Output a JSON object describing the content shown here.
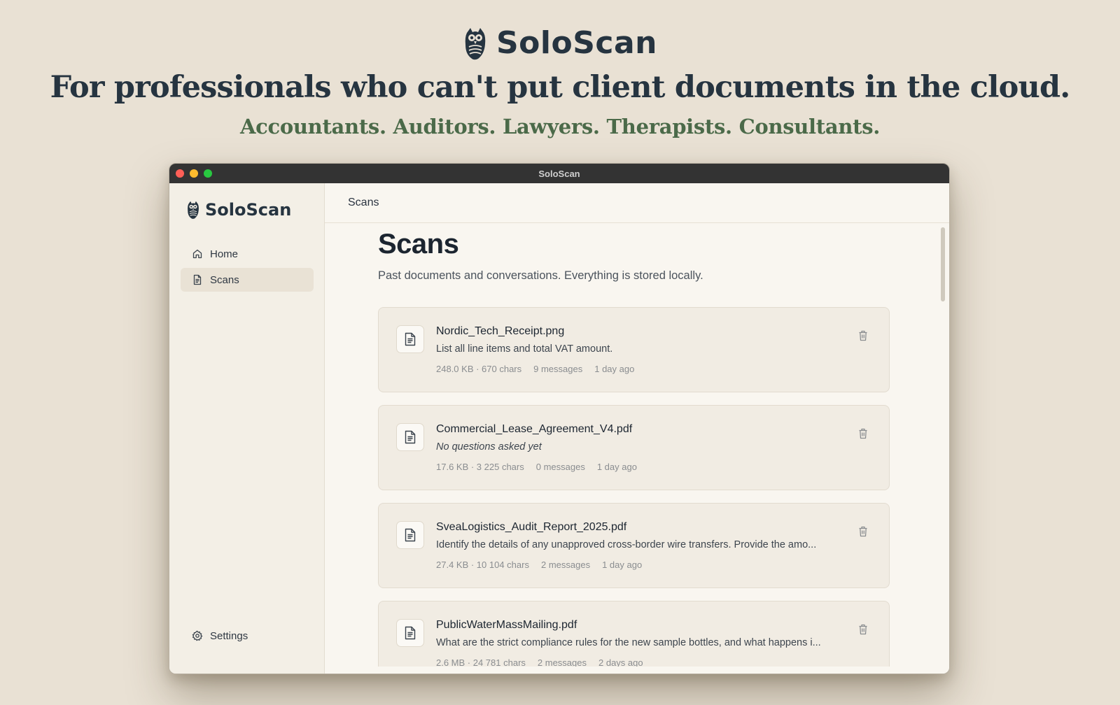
{
  "hero": {
    "brand": "SoloScan",
    "headline": "For professionals who can't put client documents in the cloud.",
    "subheadline": "Accountants. Auditors. Lawyers. Therapists. Consultants."
  },
  "window": {
    "title": "SoloScan"
  },
  "sidebar": {
    "brand": "SoloScan",
    "items": [
      {
        "label": "Home",
        "icon": "home-icon",
        "active": false
      },
      {
        "label": "Scans",
        "icon": "document-icon",
        "active": true
      }
    ],
    "settings_label": "Settings"
  },
  "main": {
    "header_title": "Scans",
    "page_title": "Scans",
    "description": "Past documents and conversations. Everything is stored locally.",
    "scans": [
      {
        "file_name": "Nordic_Tech_Receipt.png",
        "question": "List all line items and total VAT amount.",
        "size_chars": "248.0 KB · 670 chars",
        "messages": "9 messages",
        "age": "1 day ago"
      },
      {
        "file_name": "Commercial_Lease_Agreement_V4.pdf",
        "question": "No questions asked yet",
        "size_chars": "17.6 KB · 3 225 chars",
        "messages": "0 messages",
        "age": "1 day ago"
      },
      {
        "file_name": "SveaLogistics_Audit_Report_2025.pdf",
        "question": "Identify the details of any unapproved cross-border wire transfers. Provide the amo...",
        "size_chars": "27.4 KB · 10 104 chars",
        "messages": "2 messages",
        "age": "1 day ago"
      },
      {
        "file_name": "PublicWaterMassMailing.pdf",
        "question": "What are the strict compliance rules for the new sample bottles, and what happens i...",
        "size_chars": "2.6 MB · 24 781 chars",
        "messages": "2 messages",
        "age": "2 days ago"
      }
    ]
  },
  "colors": {
    "background": "#e9e1d4",
    "brand_dark": "#263440",
    "subheadline_green": "#4b6a49",
    "titlebar": "#333333"
  }
}
